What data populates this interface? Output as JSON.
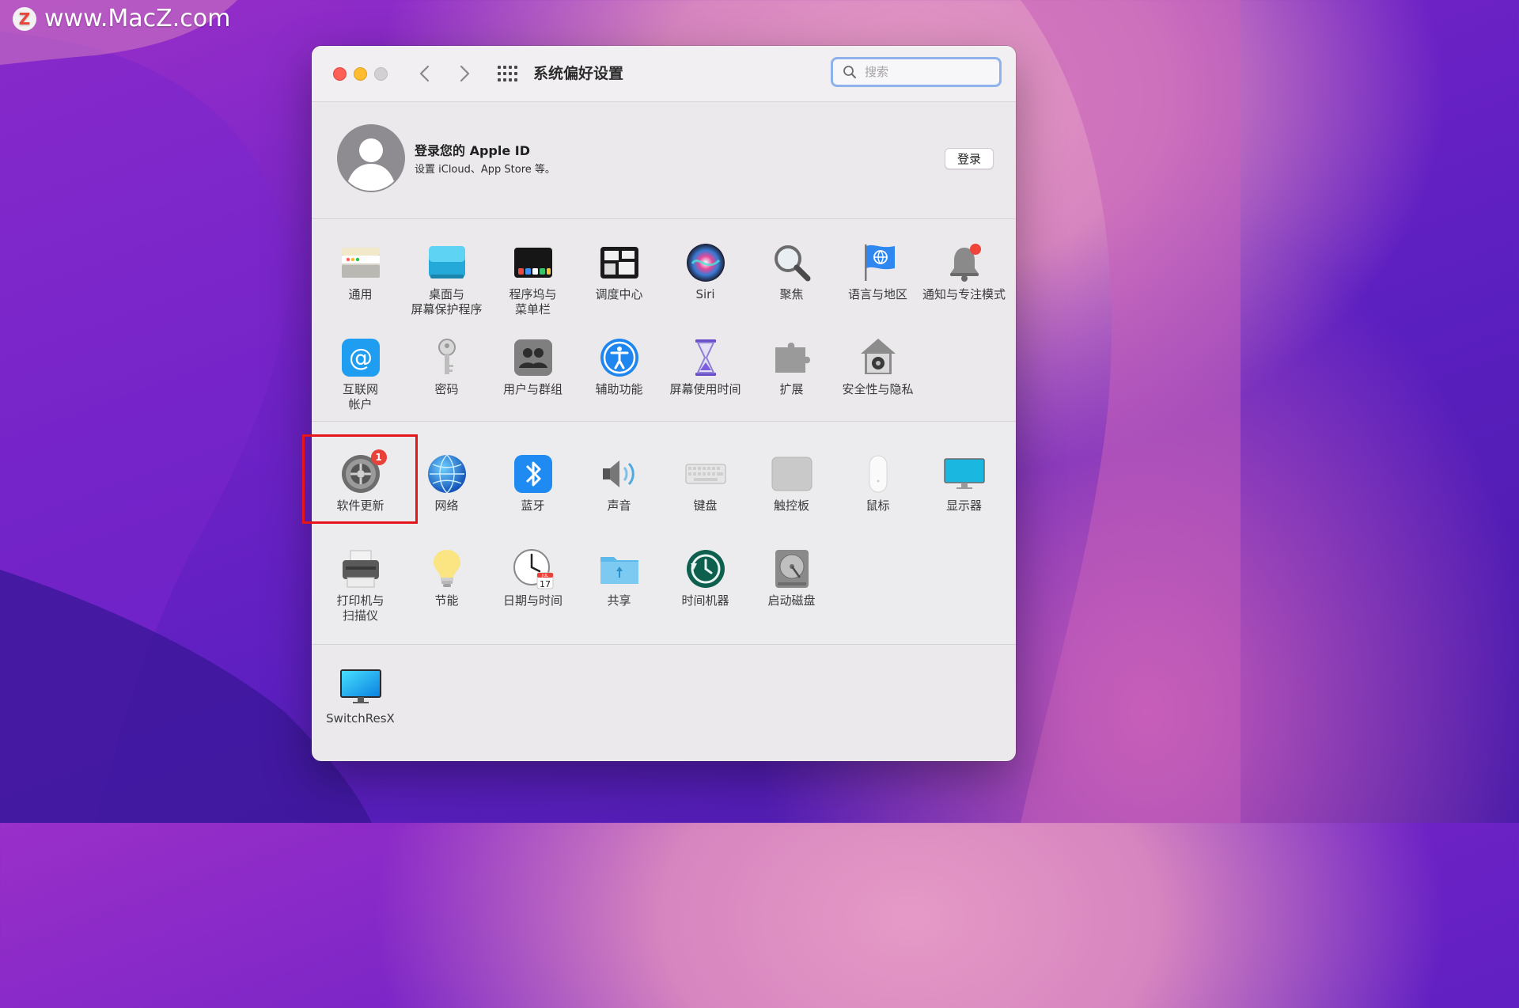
{
  "watermark": {
    "logo": "Z",
    "text": "www.MacZ.com"
  },
  "window": {
    "title": "系统偏好设置",
    "search": {
      "placeholder": "搜索",
      "value": ""
    }
  },
  "apple_id": {
    "title": "登录您的 Apple ID",
    "subtitle": "设置 iCloud、App Store 等。",
    "login_button": "登录"
  },
  "sections": [
    {
      "rows": [
        [
          {
            "id": "general",
            "label": "通用",
            "icon": "general-icon"
          },
          {
            "id": "desktop",
            "label": "桌面与\n屏幕保护程序",
            "icon": "desktop-icon"
          },
          {
            "id": "dock",
            "label": "程序坞与\n菜单栏",
            "icon": "dock-icon"
          },
          {
            "id": "mission",
            "label": "调度中心",
            "icon": "mission-control-icon"
          },
          {
            "id": "siri",
            "label": "Siri",
            "icon": "siri-icon"
          },
          {
            "id": "spotlight",
            "label": "聚焦",
            "icon": "spotlight-icon"
          },
          {
            "id": "language",
            "label": "语言与地区",
            "icon": "language-region-icon"
          },
          {
            "id": "notifications",
            "label": "通知与专注模式",
            "icon": "notifications-icon"
          }
        ],
        [
          {
            "id": "internet",
            "label": "互联网\n帐户",
            "icon": "internet-accounts-icon"
          },
          {
            "id": "passwords",
            "label": "密码",
            "icon": "passwords-icon"
          },
          {
            "id": "users",
            "label": "用户与群组",
            "icon": "users-groups-icon"
          },
          {
            "id": "accessibility",
            "label": "辅助功能",
            "icon": "accessibility-icon"
          },
          {
            "id": "screentime",
            "label": "屏幕使用时间",
            "icon": "screen-time-icon"
          },
          {
            "id": "extensions",
            "label": "扩展",
            "icon": "extensions-icon"
          },
          {
            "id": "security",
            "label": "安全性与隐私",
            "icon": "security-privacy-icon"
          }
        ]
      ]
    },
    {
      "rows": [
        [
          {
            "id": "softwareupdate",
            "label": "软件更新",
            "icon": "software-update-icon",
            "badge": "1"
          },
          {
            "id": "network",
            "label": "网络",
            "icon": "network-icon"
          },
          {
            "id": "bluetooth",
            "label": "蓝牙",
            "icon": "bluetooth-icon"
          },
          {
            "id": "sound",
            "label": "声音",
            "icon": "sound-icon"
          },
          {
            "id": "keyboard",
            "label": "键盘",
            "icon": "keyboard-icon"
          },
          {
            "id": "trackpad",
            "label": "触控板",
            "icon": "trackpad-icon"
          },
          {
            "id": "mouse",
            "label": "鼠标",
            "icon": "mouse-icon"
          },
          {
            "id": "displays",
            "label": "显示器",
            "icon": "displays-icon"
          }
        ],
        [
          {
            "id": "printers",
            "label": "打印机与\n扫描仪",
            "icon": "printers-scanners-icon"
          },
          {
            "id": "energy",
            "label": "节能",
            "icon": "energy-saver-icon"
          },
          {
            "id": "datetime",
            "label": "日期与时间",
            "icon": "date-time-icon",
            "calendar_day": "17",
            "calendar_month": "JUL"
          },
          {
            "id": "sharing",
            "label": "共享",
            "icon": "sharing-icon"
          },
          {
            "id": "timemachine",
            "label": "时间机器",
            "icon": "time-machine-icon"
          },
          {
            "id": "startupdisk",
            "label": "启动磁盘",
            "icon": "startup-disk-icon"
          }
        ]
      ]
    },
    {
      "rows": [
        [
          {
            "id": "switchresx",
            "label": "SwitchResX",
            "icon": "switchresx-icon"
          }
        ]
      ]
    }
  ],
  "colors": {
    "highlight_border": "#e4151b",
    "search_focus": "#8fb2ec",
    "badge": "#e8413a"
  }
}
